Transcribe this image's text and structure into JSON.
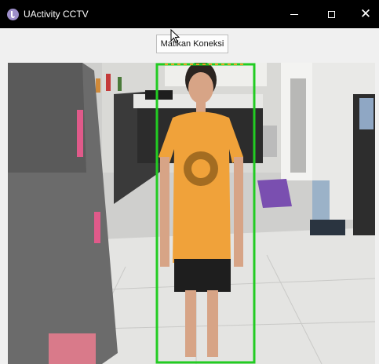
{
  "window": {
    "title": "UActivity CCTV",
    "icon": "app-icon",
    "controls": {
      "minimize_icon": "minimize-icon",
      "maximize_icon": "maximize-icon",
      "close_icon": "close-icon"
    }
  },
  "toolbar": {
    "connect_button_label": "Matikan Koneksi"
  },
  "video": {
    "detection_box_color": "#22cc22"
  }
}
